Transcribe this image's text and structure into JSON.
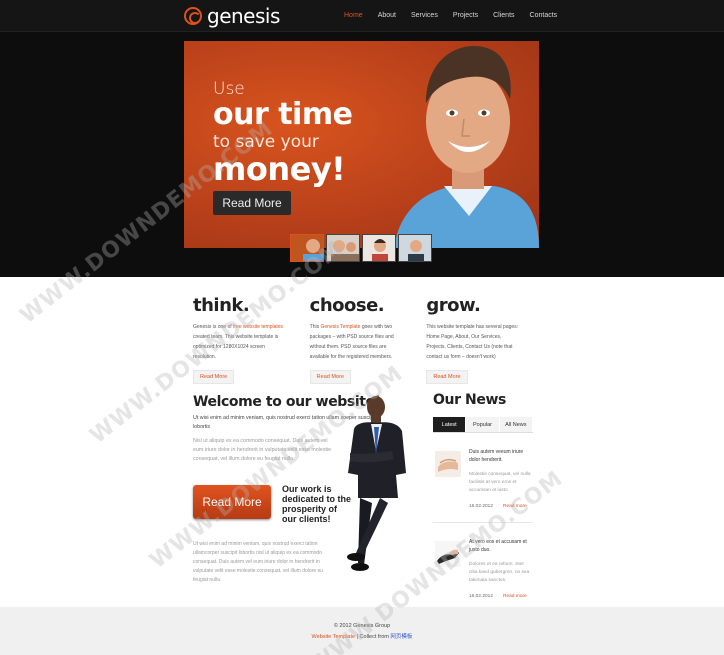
{
  "brand": {
    "name": "genesis",
    "accent": "#e0501b"
  },
  "nav": {
    "items": [
      {
        "label": "Home",
        "active": true
      },
      {
        "label": "About",
        "active": false
      },
      {
        "label": "Services",
        "active": false
      },
      {
        "label": "Projects",
        "active": false
      },
      {
        "label": "Clients",
        "active": false
      },
      {
        "label": "Contacts",
        "active": false
      }
    ]
  },
  "hero": {
    "line1": "Use",
    "line2": "our time",
    "line3": "to save your",
    "line4": "money!",
    "button": "Read More"
  },
  "columns": [
    {
      "title": "think.",
      "text_a": "Genesis is one of ",
      "link": "free website templates",
      "text_b": " created team. This website template is optimized for 1280X1024 screen resolution.",
      "button": "Read More"
    },
    {
      "title": "choose.",
      "text_a": "This ",
      "link": "Genesis Template",
      "text_b": " goes with two packages – with PSD source files and without them. PSD source files are available for the registered members.",
      "button": "Read More"
    },
    {
      "title": "grow.",
      "text_a": "",
      "link": "",
      "text_b": "This website template has several pages: Home Page, About, Our Services, Projects, Clients, Contact Us (note that contact us form – doesn't work)",
      "button": "Read More"
    }
  ],
  "welcome": {
    "title": "Welcome to our website!",
    "intro": "Ut wisi enim ad minim veniam, quis nostrud exerci tation ullam soeper suscipit lobortis",
    "muted": "Nisl ut aliquip ex ea commodo consequat. Duis autem vel eum iriure dolor in hendrerit in vulputate velit esse molestie consequat, vel illum dolore eu feugiat nulla.",
    "button": "Read More",
    "tagline": "Our work is dedicated to the prosperity of our clients!",
    "para2": "Ut wisi enim ad minim veniam, quis nostrud exerci tation ullamcorper suscipit lobortis nisl ut aliquip ex ea commodo consequat. Duis autem vel eum iriure dolor in hendrerit in vulputate velit esse molestie consequat, vel illum dolore eu feugiat nulla."
  },
  "news": {
    "title": "Our News",
    "tabs": [
      {
        "label": "Latest",
        "active": true
      },
      {
        "label": "Popular",
        "active": false
      },
      {
        "label": "All News",
        "active": false
      }
    ],
    "items": [
      {
        "title": "Duis autem veeum iriure dolor hendrerit.",
        "body": "Molestie consequat, vel nulla facilisis at vero eros et accumsan et iusto",
        "date": "16.02.2012",
        "more": "Read more"
      },
      {
        "title": "At vero eos et accusam et justo duo.",
        "body": "Dolores et ea rebum. Stet clita kasd gubergren, no sea takimata sanctus.",
        "date": "16.02.2012",
        "more": "Read more"
      }
    ]
  },
  "footer": {
    "copyright": "© 2012 Genesis Group",
    "link1": "Website Template",
    "sep": " | Collect from ",
    "link2": "网页模板"
  },
  "watermark": "WWW.DOWNDEMO.COM"
}
